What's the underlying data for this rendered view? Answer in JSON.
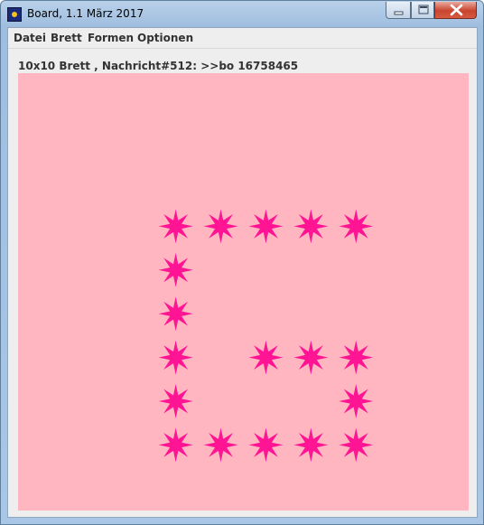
{
  "window": {
    "title": "Board, 1.1 März 2017"
  },
  "menu": [
    {
      "label": "Datei"
    },
    {
      "label": "Brett"
    },
    {
      "label": "Formen"
    },
    {
      "label": "Optionen"
    }
  ],
  "status": {
    "text": "10x10 Brett , Nachricht#512: >>bo 16758465"
  },
  "board": {
    "size": 10,
    "background_color": "#ffb6c1",
    "star_color": "#ff1493",
    "star_points": 8,
    "stars": [
      {
        "col": 3,
        "row": 3
      },
      {
        "col": 4,
        "row": 3
      },
      {
        "col": 5,
        "row": 3
      },
      {
        "col": 6,
        "row": 3
      },
      {
        "col": 7,
        "row": 3
      },
      {
        "col": 3,
        "row": 4
      },
      {
        "col": 3,
        "row": 5
      },
      {
        "col": 3,
        "row": 6
      },
      {
        "col": 5,
        "row": 6
      },
      {
        "col": 6,
        "row": 6
      },
      {
        "col": 7,
        "row": 6
      },
      {
        "col": 3,
        "row": 7
      },
      {
        "col": 7,
        "row": 7
      },
      {
        "col": 3,
        "row": 8
      },
      {
        "col": 4,
        "row": 8
      },
      {
        "col": 5,
        "row": 8
      },
      {
        "col": 6,
        "row": 8
      },
      {
        "col": 7,
        "row": 8
      }
    ]
  }
}
